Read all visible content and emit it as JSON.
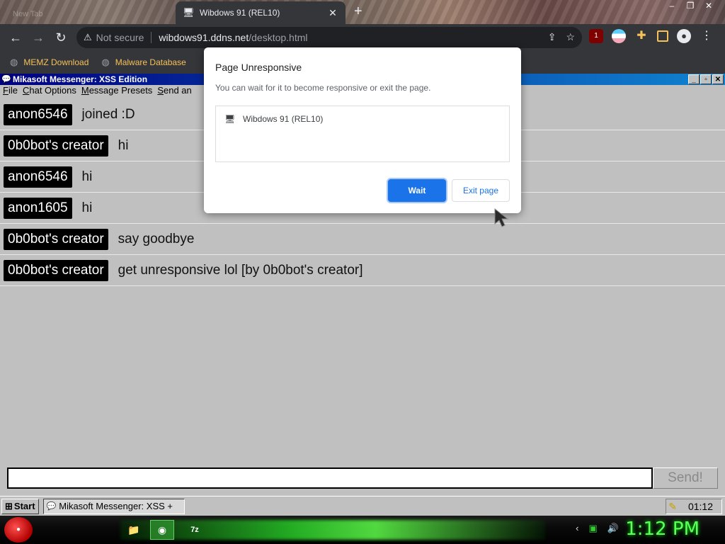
{
  "browser": {
    "background_tab_title": "New Tab",
    "active_tab_title": "Wibdows 91 (REL10)",
    "tab_close": "✕",
    "new_tab": "+",
    "window_controls": [
      "–",
      "❐",
      "✕"
    ],
    "security_label": "Not secure",
    "url_host": "wibdows91.ddns.net",
    "url_path": "/desktop.html",
    "bookmarks": [
      {
        "label": "MEMZ Download",
        "icon": "globe-icon"
      },
      {
        "label": "Malware Database",
        "icon": "globe-icon"
      }
    ],
    "extension_badge": "1"
  },
  "messenger": {
    "title": "Mikasoft Messenger: XSS Edition",
    "menu": [
      "File",
      "Chat Options",
      "Message Presets",
      "Send an"
    ],
    "messages": [
      {
        "user": "anon6546",
        "text": "joined :D"
      },
      {
        "user": "0b0bot's creator",
        "text": "hi"
      },
      {
        "user": "anon6546",
        "text": "hi"
      },
      {
        "user": "anon1605",
        "text": "hi"
      },
      {
        "user": "0b0bot's creator",
        "text": "say goodbye"
      },
      {
        "user": "0b0bot's creator",
        "text": "get unresponsive lol  [by 0b0bot's creator]"
      }
    ],
    "input_value": "",
    "send_label": "Send!"
  },
  "w91_taskbar": {
    "start_label": "Start",
    "task_label": "Mikasoft Messenger: XSS +",
    "tray_time": "01:12"
  },
  "os_taskbar": {
    "clock": "1:12 PM"
  },
  "dialog": {
    "title": "Page Unresponsive",
    "subtitle": "You can wait for it to become responsive or exit the page.",
    "page_item": "Wibdows 91 (REL10)",
    "wait_label": "Wait",
    "exit_label": "Exit page"
  },
  "colors": {
    "accent_blue": "#1a73e8",
    "titlebar_start": "#000080",
    "os_clock_green": "#5dff5d"
  }
}
